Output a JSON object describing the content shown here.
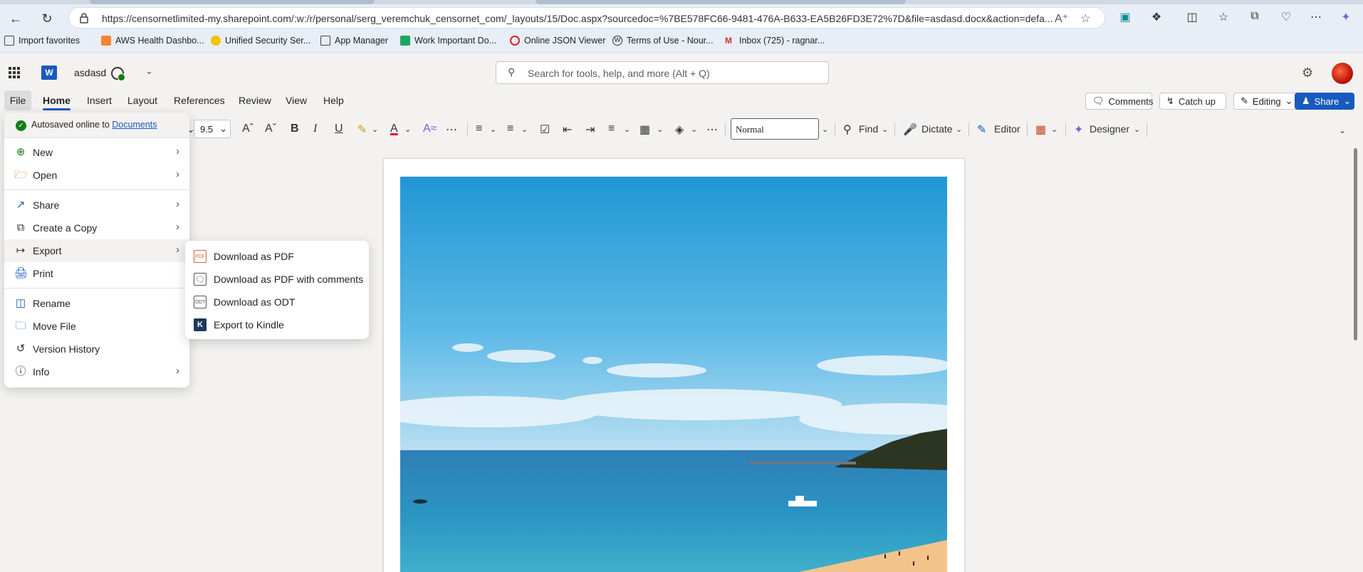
{
  "browser": {
    "url": "https://censornetlimited-my.sharepoint.com/:w:/r/personal/serg_veremchuk_censornet_com/_layouts/15/Doc.aspx?sourcedoc=%7BE578FC66-9481-476A-B633-EA5B26FD3E72%7D&file=asdasd.docx&action=defa...",
    "favorites": [
      {
        "label": "Import favorites",
        "icon": "folder-import-icon"
      },
      {
        "label": "AWS Health Dashbo...",
        "icon": "aws-icon"
      },
      {
        "label": "Unified Security Ser...",
        "icon": "security-icon"
      },
      {
        "label": "App Manager",
        "icon": "page-icon"
      },
      {
        "label": "Work Important Do...",
        "icon": "sheet-icon"
      },
      {
        "label": "Online JSON Viewer",
        "icon": "json-icon"
      },
      {
        "label": "Terms of Use - Nour...",
        "icon": "wordpress-icon"
      },
      {
        "label": "Inbox (725) - ragnar...",
        "icon": "gmail-icon"
      }
    ]
  },
  "word": {
    "doc_name": "asdasd",
    "search_placeholder": "Search for tools, help, and more (Alt + Q)"
  },
  "menubar": {
    "tabs": [
      "File",
      "Home",
      "Insert",
      "Layout",
      "References",
      "Review",
      "View",
      "Help"
    ],
    "comments": "Comments",
    "catchup": "Catch up",
    "editing": "Editing",
    "share": "Share"
  },
  "ribbon": {
    "font_size": "9.5",
    "style": "Normal",
    "find": "Find",
    "dictate": "Dictate",
    "editor": "Editor",
    "designer": "Designer"
  },
  "filemenu": {
    "autosave_prefix": "Autosaved online to ",
    "autosave_link": "Documents",
    "items": [
      {
        "label": "New",
        "icon": "new-icon"
      },
      {
        "label": "Open",
        "icon": "folder-icon"
      },
      {
        "label": "Share",
        "icon": "share-icon"
      },
      {
        "label": "Create a Copy",
        "icon": "copy-icon"
      },
      {
        "label": "Export",
        "icon": "export-icon"
      },
      {
        "label": "Print",
        "icon": "print-icon"
      },
      {
        "label": "Rename",
        "icon": "rename-icon"
      },
      {
        "label": "Move File",
        "icon": "move-file-icon"
      },
      {
        "label": "Version History",
        "icon": "history-icon"
      },
      {
        "label": "Info",
        "icon": "info-icon"
      }
    ]
  },
  "export_submenu": {
    "items": [
      {
        "label": "Download as PDF",
        "icon": "pdf-icon"
      },
      {
        "label": "Download as PDF with comments",
        "icon": "pdf-comments-icon"
      },
      {
        "label": "Download as ODT",
        "icon": "odt-icon"
      },
      {
        "label": "Export to Kindle",
        "icon": "kindle-icon"
      }
    ],
    "pdf_badge": "PDF",
    "odt_badge": "ODT"
  },
  "colors": {
    "accent": "#185abd",
    "sync_green": "#107c10",
    "font_color_red": "#e81123"
  }
}
